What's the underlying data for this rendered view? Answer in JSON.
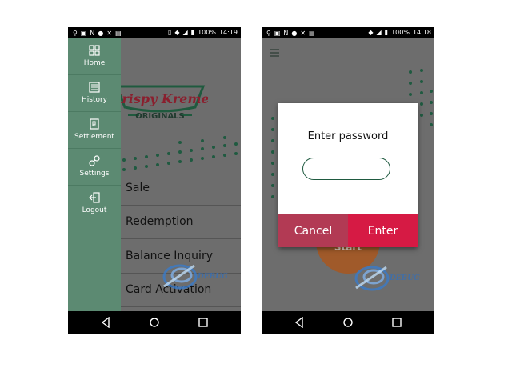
{
  "left": {
    "status_bar": {
      "battery": "100%",
      "time": "14:19"
    },
    "drawer": {
      "items": [
        {
          "label": "Home",
          "icon": "grid-icon"
        },
        {
          "label": "History",
          "icon": "list-icon"
        },
        {
          "label": "Settlement",
          "icon": "document-icon"
        },
        {
          "label": "Settings",
          "icon": "link-icon"
        },
        {
          "label": "Logout",
          "icon": "logout-icon"
        }
      ]
    },
    "brand": {
      "line1": "Krispy Kreme",
      "line2": "ORIGINALS"
    },
    "menu": {
      "items": [
        "Sale",
        "Redemption",
        "Balance Inquiry",
        "Card Activation"
      ]
    },
    "watermark": "DEBUG"
  },
  "right": {
    "status_bar": {
      "battery": "100%",
      "time": "14:18"
    },
    "dialog": {
      "title": "Enter password",
      "input_value": "",
      "cancel_label": "Cancel",
      "enter_label": "Enter"
    },
    "donut_label": "Start",
    "watermark": "DEBUG"
  },
  "colors": {
    "drawer": "#5c8a72",
    "accent": "#d61a44",
    "cancel": "#b23a54",
    "input_border": "#1f5a40"
  }
}
